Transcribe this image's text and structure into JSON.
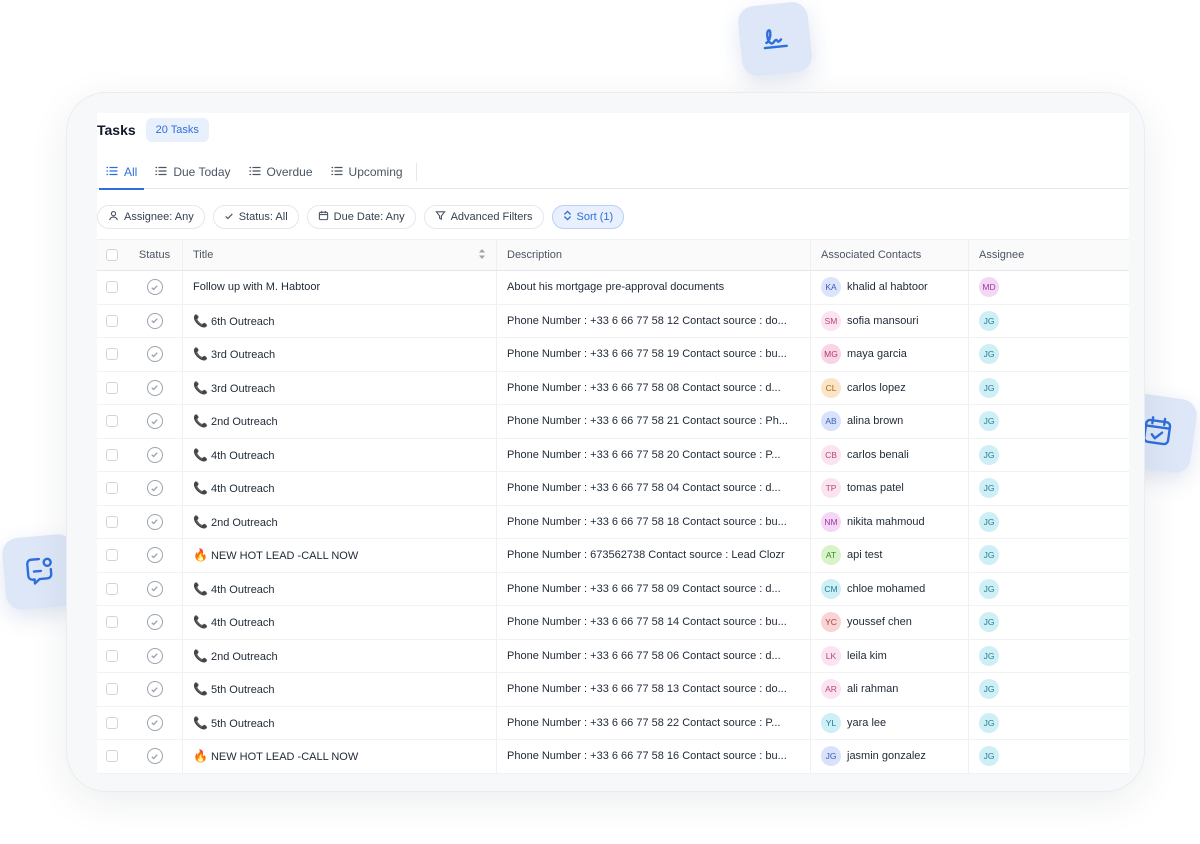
{
  "header": {
    "title": "Tasks",
    "count_badge": "20 Tasks"
  },
  "tabs": [
    {
      "label": "All",
      "active": true
    },
    {
      "label": "Due Today",
      "active": false
    },
    {
      "label": "Overdue",
      "active": false
    },
    {
      "label": "Upcoming",
      "active": false
    }
  ],
  "filters": {
    "assignee": "Assignee: Any",
    "status": "Status: All",
    "due_date": "Due Date: Any",
    "advanced": "Advanced Filters",
    "sort": "Sort (1)"
  },
  "columns": {
    "status": "Status",
    "title": "Title",
    "description": "Description",
    "contacts": "Associated Contacts",
    "assignee": "Assignee"
  },
  "colors": {
    "accent": "#2f6fdb",
    "accent_bg": "#e8f0fd"
  },
  "rows": [
    {
      "icon": "",
      "title": "Follow up with M. Habtoor",
      "description": "About his mortgage pre-approval documents",
      "contact_initials": "KA",
      "contact_name": "khalid al habtoor",
      "contact_bg": "#dbe4fb",
      "contact_fg": "#3b5bbd",
      "assignee": "MD",
      "assignee_bg": "#f4d7f5",
      "assignee_fg": "#9b3aa0"
    },
    {
      "icon": "📞",
      "title": "6th Outreach",
      "description": "Phone Number : +33 6 66 77 58 12 Contact source : do...",
      "contact_initials": "SM",
      "contact_name": "sofia mansouri",
      "contact_bg": "#fbe3ef",
      "contact_fg": "#b34a7c",
      "assignee": "JG",
      "assignee_bg": "#cdeff5",
      "assignee_fg": "#1f7e93"
    },
    {
      "icon": "📞",
      "title": "3rd Outreach",
      "description": "Phone Number : +33 6 66 77 58 19 Contact source : bu...",
      "contact_initials": "MG",
      "contact_name": "maya garcia",
      "contact_bg": "#f8d4e4",
      "contact_fg": "#b0396e",
      "assignee": "JG",
      "assignee_bg": "#cdeff5",
      "assignee_fg": "#1f7e93"
    },
    {
      "icon": "📞",
      "title": "3rd Outreach",
      "description": "Phone Number : +33 6 66 77 58 08 Contact source : d...",
      "contact_initials": "CL",
      "contact_name": "carlos lopez",
      "contact_bg": "#fbe5c6",
      "contact_fg": "#a8661a",
      "assignee": "JG",
      "assignee_bg": "#cdeff5",
      "assignee_fg": "#1f7e93"
    },
    {
      "icon": "📞",
      "title": "2nd Outreach",
      "description": "Phone Number : +33 6 66 77 58 21 Contact source : Ph...",
      "contact_initials": "AB",
      "contact_name": "alina brown",
      "contact_bg": "#d9e2fb",
      "contact_fg": "#3b5bbd",
      "assignee": "JG",
      "assignee_bg": "#cdeff5",
      "assignee_fg": "#1f7e93"
    },
    {
      "icon": "📞",
      "title": "4th Outreach",
      "description": "Phone Number : +33 6 66 77 58 20 Contact source : P...",
      "contact_initials": "CB",
      "contact_name": "carlos benali",
      "contact_bg": "#fbe3ef",
      "contact_fg": "#b34a7c",
      "assignee": "JG",
      "assignee_bg": "#cdeff5",
      "assignee_fg": "#1f7e93"
    },
    {
      "icon": "📞",
      "title": "4th Outreach",
      "description": "Phone Number : +33 6 66 77 58 04 Contact source : d...",
      "contact_initials": "TP",
      "contact_name": "tomas patel",
      "contact_bg": "#fbe3ef",
      "contact_fg": "#b34a7c",
      "assignee": "JG",
      "assignee_bg": "#cdeff5",
      "assignee_fg": "#1f7e93"
    },
    {
      "icon": "📞",
      "title": "2nd Outreach",
      "description": "Phone Number : +33 6 66 77 58 18 Contact source : bu...",
      "contact_initials": "NM",
      "contact_name": "nikita mahmoud",
      "contact_bg": "#f4d7f5",
      "contact_fg": "#9b3aa0",
      "assignee": "JG",
      "assignee_bg": "#cdeff5",
      "assignee_fg": "#1f7e93"
    },
    {
      "icon": "🔥",
      "title": "NEW HOT LEAD -CALL NOW",
      "description": "Phone Number : 673562738 Contact source : Lead Clozr",
      "contact_initials": "AT",
      "contact_name": "api test",
      "contact_bg": "#d8f3c9",
      "contact_fg": "#3f8a22",
      "assignee": "JG",
      "assignee_bg": "#cdeff5",
      "assignee_fg": "#1f7e93"
    },
    {
      "icon": "📞",
      "title": "4th Outreach",
      "description": "Phone Number : +33 6 66 77 58 09 Contact source : d...",
      "contact_initials": "CM",
      "contact_name": "chloe mohamed",
      "contact_bg": "#cdeff5",
      "contact_fg": "#1f7e93",
      "assignee": "JG",
      "assignee_bg": "#cdeff5",
      "assignee_fg": "#1f7e93"
    },
    {
      "icon": "📞",
      "title": "4th Outreach",
      "description": "Phone Number : +33 6 66 77 58 14 Contact source : bu...",
      "contact_initials": "YC",
      "contact_name": "youssef chen",
      "contact_bg": "#f8d4d4",
      "contact_fg": "#b03939",
      "assignee": "JG",
      "assignee_bg": "#cdeff5",
      "assignee_fg": "#1f7e93"
    },
    {
      "icon": "📞",
      "title": "2nd Outreach",
      "description": "Phone Number : +33 6 66 77 58 06 Contact source : d...",
      "contact_initials": "LK",
      "contact_name": "leila kim",
      "contact_bg": "#fbe3ef",
      "contact_fg": "#b34a7c",
      "assignee": "JG",
      "assignee_bg": "#cdeff5",
      "assignee_fg": "#1f7e93"
    },
    {
      "icon": "📞",
      "title": "5th Outreach",
      "description": "Phone Number : +33 6 66 77 58 13 Contact source : do...",
      "contact_initials": "AR",
      "contact_name": "ali rahman",
      "contact_bg": "#fbe3ef",
      "contact_fg": "#b34a7c",
      "assignee": "JG",
      "assignee_bg": "#cdeff5",
      "assignee_fg": "#1f7e93"
    },
    {
      "icon": "📞",
      "title": "5th Outreach",
      "description": "Phone Number : +33 6 66 77 58 22 Contact source : P...",
      "contact_initials": "YL",
      "contact_name": "yara lee",
      "contact_bg": "#cdeff5",
      "contact_fg": "#1f7e93",
      "assignee": "JG",
      "assignee_bg": "#cdeff5",
      "assignee_fg": "#1f7e93"
    },
    {
      "icon": "🔥",
      "title": "NEW HOT LEAD -CALL NOW",
      "description": "Phone Number : +33 6 66 77 58 16 Contact source : bu...",
      "contact_initials": "JG",
      "contact_name": "jasmin gonzalez",
      "contact_bg": "#d9e2fb",
      "contact_fg": "#3b5bbd",
      "assignee": "JG",
      "assignee_bg": "#cdeff5",
      "assignee_fg": "#1f7e93"
    }
  ]
}
